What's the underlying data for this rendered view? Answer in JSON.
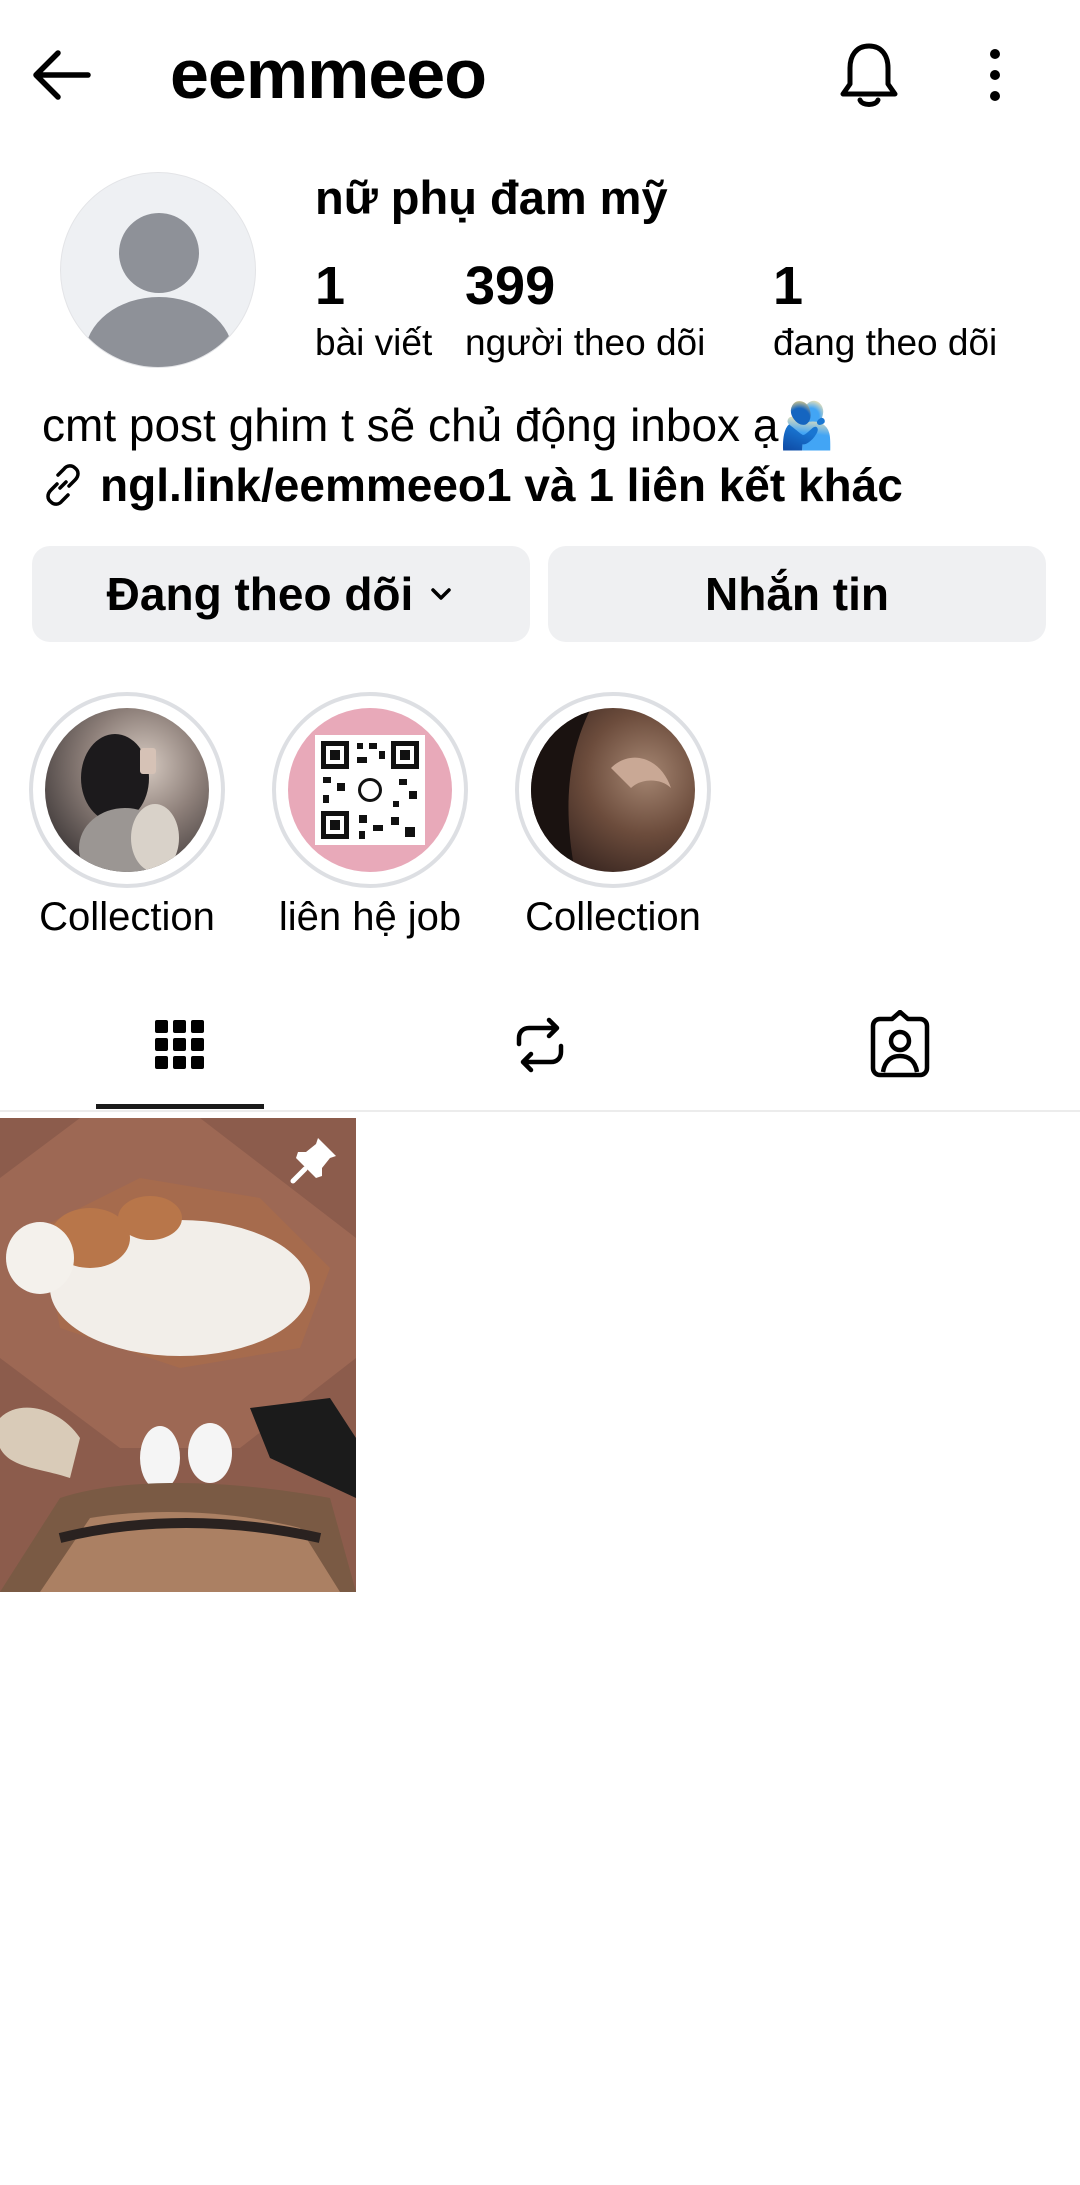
{
  "header": {
    "username": "eemmeeo",
    "back_icon": "arrow-left-icon",
    "notification_icon": "bell-icon",
    "more_icon": "more-vertical-icon"
  },
  "profile": {
    "full_name": "nữ phụ đam mỹ",
    "stats": [
      {
        "value": "1",
        "label": "bài viết"
      },
      {
        "value": "399",
        "label": "người theo dõi"
      },
      {
        "value": "1",
        "label": "đang theo dõi"
      }
    ],
    "bio": "cmt post ghim t sẽ chủ động inbox ạ🫂",
    "link_text": "ngl.link/eemmeeo1 và 1 liên kết khác"
  },
  "actions": {
    "following_label": "Đang theo dõi",
    "message_label": "Nhắn tin"
  },
  "highlights": [
    {
      "label": "Collection"
    },
    {
      "label": "liên hệ job"
    },
    {
      "label": "Collection"
    }
  ],
  "tabs": [
    "grid-icon",
    "repost-icon",
    "tagged-icon"
  ],
  "posts": [
    {
      "pinned": true
    }
  ]
}
